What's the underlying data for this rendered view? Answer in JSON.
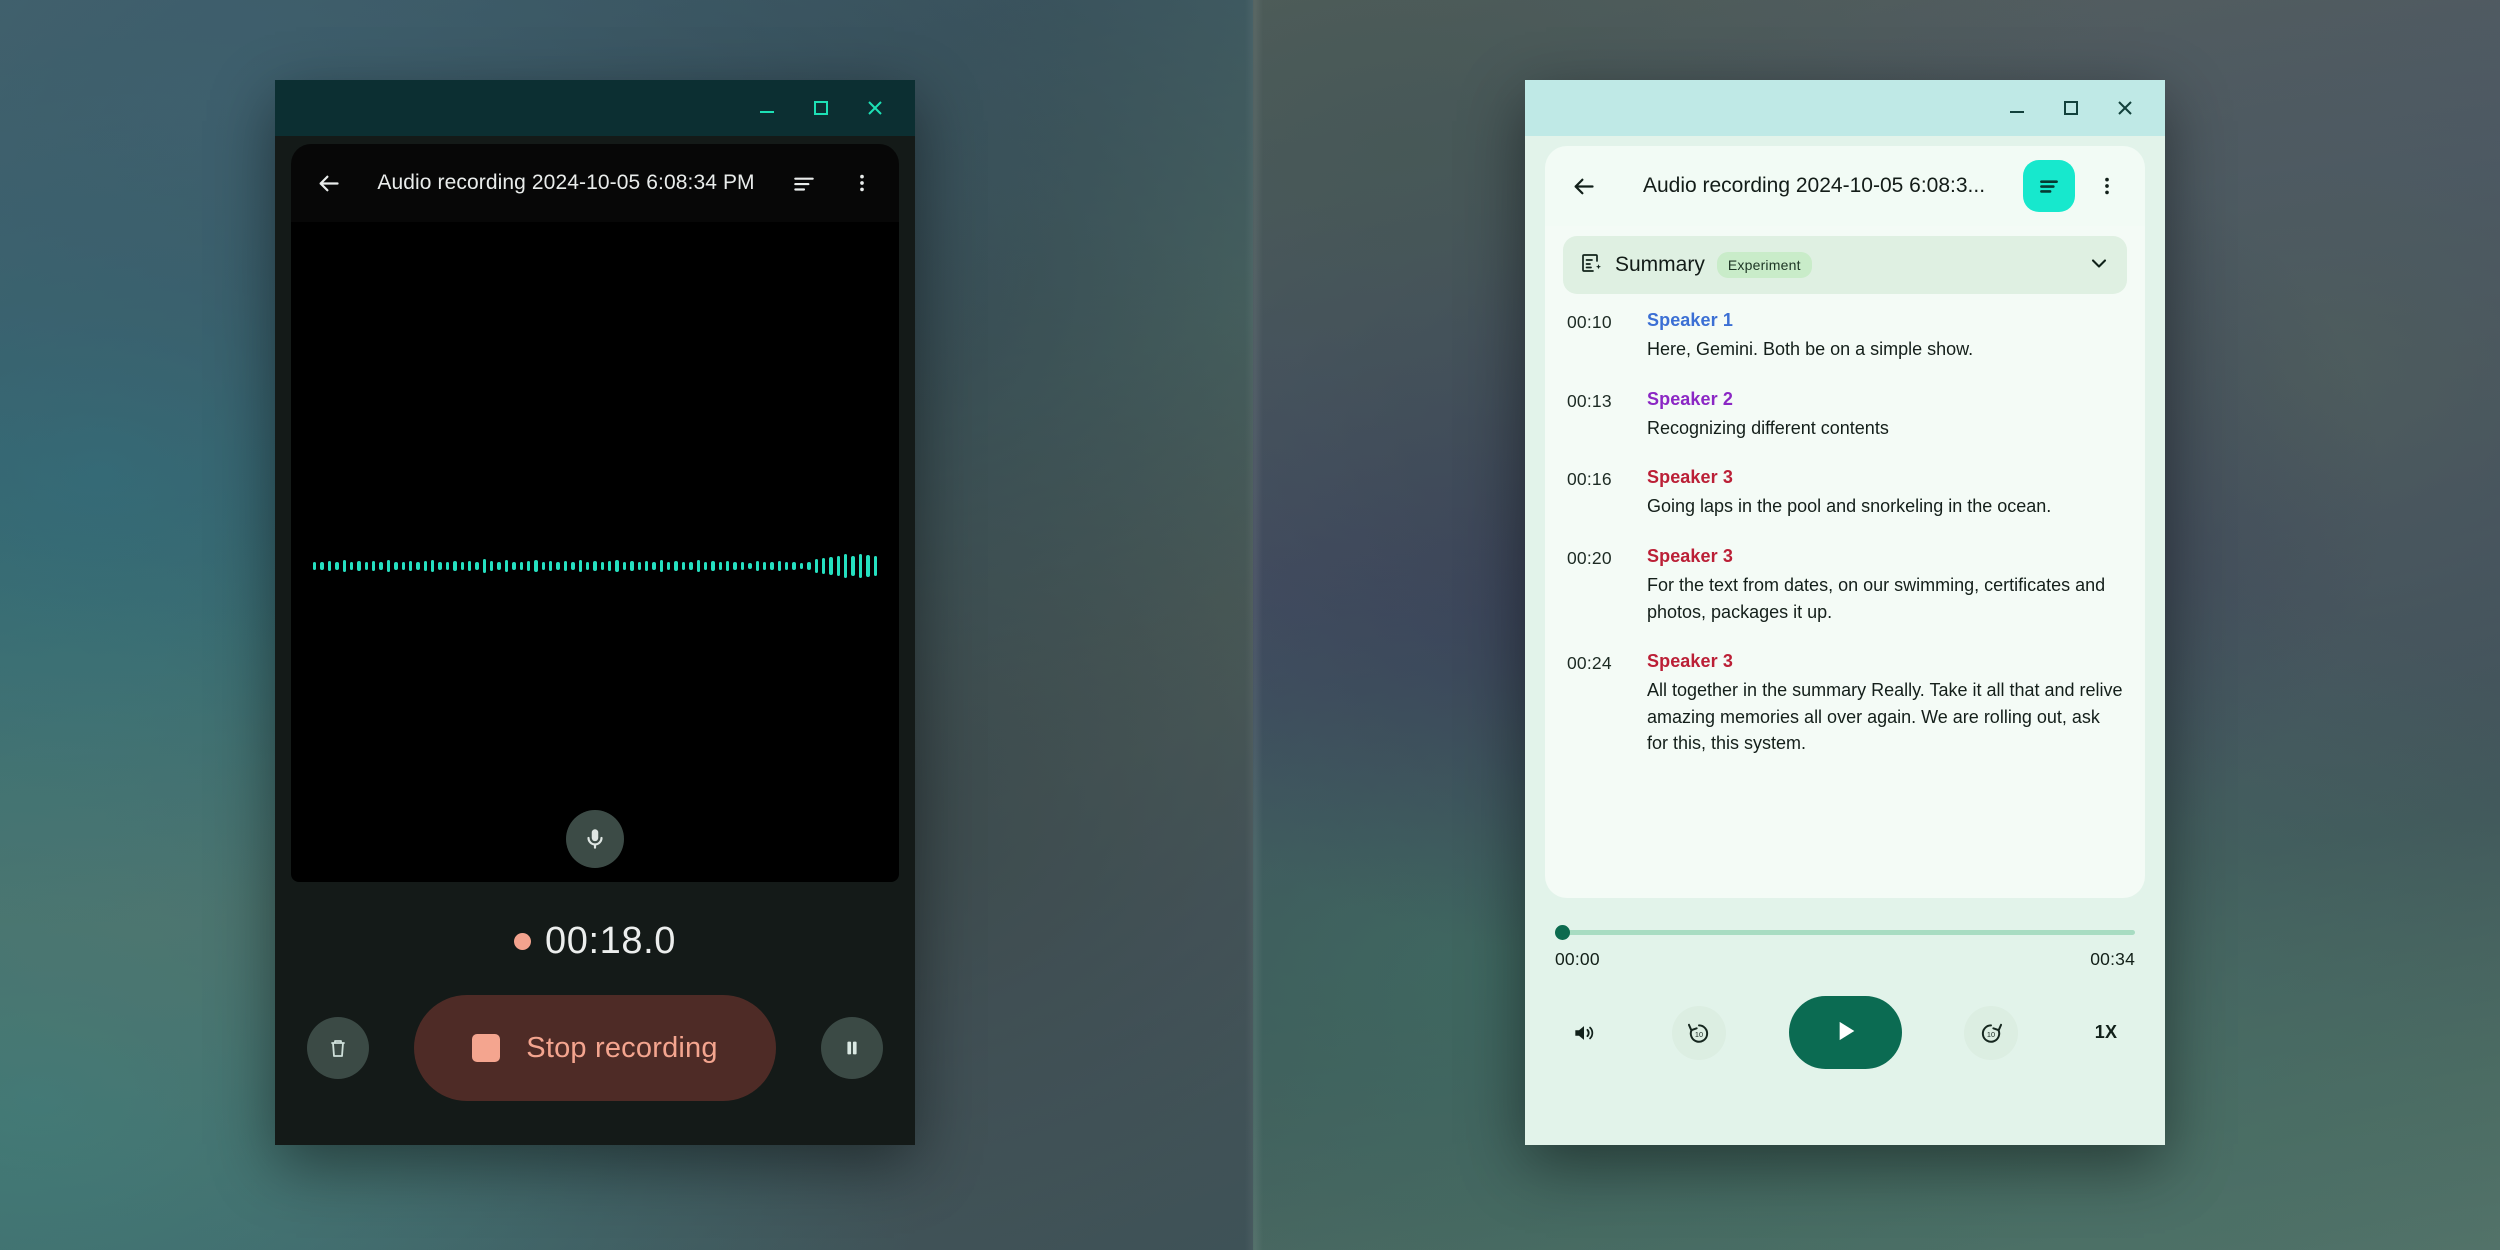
{
  "recorder_window": {
    "window_controls": {
      "minimize": "minimize-icon",
      "maximize": "maximize-icon",
      "close": "close-icon"
    },
    "appbar": {
      "back_icon": "back-arrow-icon",
      "title": "Audio recording 2024-10-05 6:08:34 PM",
      "transcript_icon": "transcript-lines-icon",
      "overflow_icon": "more-vertical-icon"
    },
    "stage": {
      "mic_icon": "microphone-icon",
      "waveform_color": "#25e0c0",
      "waveform_levels": [
        22,
        18,
        26,
        20,
        30,
        22,
        26,
        18,
        24,
        20,
        28,
        22,
        18,
        26,
        20,
        24,
        30,
        22,
        18,
        26,
        20,
        24,
        18,
        34,
        26,
        20,
        28,
        22,
        18,
        26,
        30,
        20,
        24,
        18,
        26,
        22,
        30,
        20,
        26,
        18,
        24,
        28,
        20,
        26,
        18,
        24,
        20,
        30,
        18,
        26,
        22,
        20,
        28,
        18,
        24,
        20,
        26,
        18,
        22,
        16,
        24,
        18,
        20,
        26,
        18,
        22,
        16,
        20,
        34,
        40,
        46,
        52,
        58,
        50,
        62,
        54,
        48
      ]
    },
    "timer": {
      "recording_dot": "recording-dot-icon",
      "elapsed": "00:18.0",
      "dot_color": "#f3a38e"
    },
    "controls": {
      "delete_icon": "trash-icon",
      "stop_label": "Stop recording",
      "stop_icon": "stop-square-icon",
      "stop_bg": "#4e2b26",
      "stop_fg": "#f4a58f",
      "pause_icon": "pause-icon"
    }
  },
  "player_window": {
    "window_controls": {
      "minimize": "minimize-icon",
      "maximize": "maximize-icon",
      "close": "close-icon"
    },
    "appbar": {
      "back_icon": "back-arrow-icon",
      "title": "Audio recording 2024-10-05 6:08:3...",
      "transcript_toggle_icon": "transcript-lines-icon",
      "transcript_toggle_bg": "#17e8cd",
      "overflow_icon": "more-vertical-icon"
    },
    "summary": {
      "icon": "summary-sparkle-icon",
      "label": "Summary",
      "badge": "Experiment",
      "expand_icon": "chevron-down-icon"
    },
    "transcript": [
      {
        "time": "00:10",
        "speaker": "Speaker 1",
        "color": "#3b6fd4",
        "text": "Here, Gemini. Both be on a simple show."
      },
      {
        "time": "00:13",
        "speaker": "Speaker 2",
        "color": "#8b27c4",
        "text": "Recognizing different contents"
      },
      {
        "time": "00:16",
        "speaker": "Speaker 3",
        "color": "#bb1f36",
        "text": "Going laps in the pool and snorkeling in the ocean."
      },
      {
        "time": "00:20",
        "speaker": "Speaker 3",
        "color": "#bb1f36",
        "text": "For the text from dates, on our swimming, certificates and photos, packages it up."
      },
      {
        "time": "00:24",
        "speaker": "Speaker 3",
        "color": "#bb1f36",
        "text": "All together in the summary Really. Take it all that and relive amazing memories all over again. We are rolling out, ask for this, this system."
      }
    ],
    "playback": {
      "position_percent": 0,
      "current_time": "00:00",
      "total_time": "00:34",
      "volume_icon": "volume-icon",
      "rewind_icon": "replay-10-icon",
      "rewind_seconds": "10",
      "forward_icon": "forward-10-icon",
      "forward_seconds": "10",
      "play_icon": "play-icon",
      "play_bg": "#0b6b52",
      "speed_label": "1X"
    }
  }
}
